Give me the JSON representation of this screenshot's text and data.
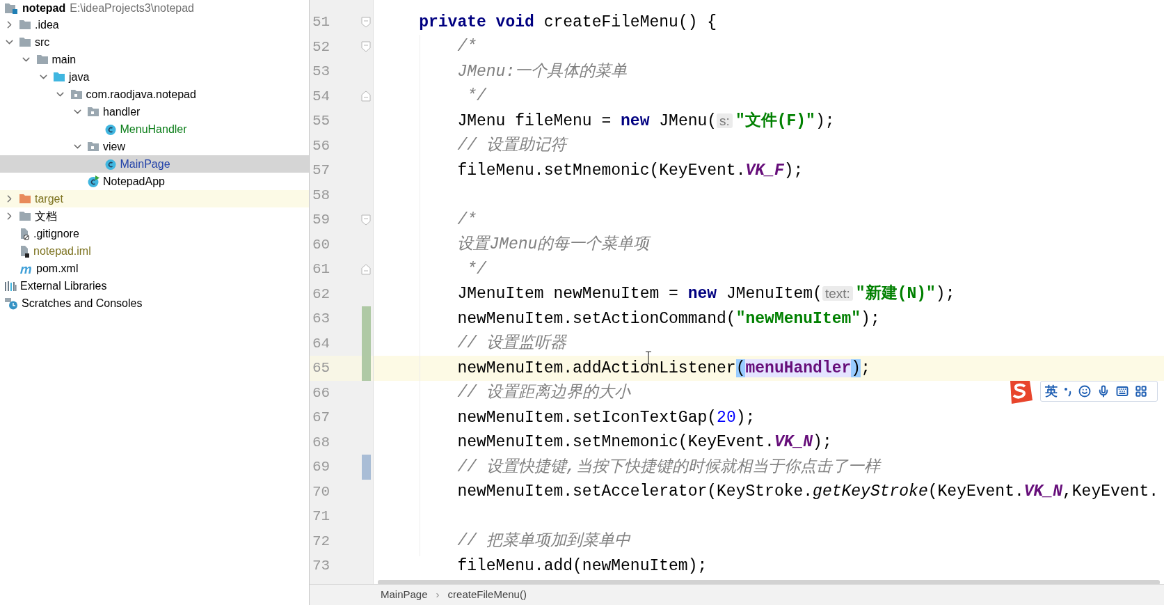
{
  "project": {
    "name": "notepad",
    "path": "E:\\ideaProjects3\\notepad",
    "tree": [
      {
        "label": ".idea",
        "kind": "folder",
        "color": "#000000",
        "expanded": false,
        "selected": false
      },
      {
        "label": "src",
        "kind": "folder",
        "color": "#000000",
        "expanded": true,
        "selected": false,
        "children": [
          {
            "label": "main",
            "kind": "folder",
            "color": "#000000",
            "expanded": true,
            "selected": false,
            "children": [
              {
                "label": "java",
                "kind": "sources",
                "color": "#000000",
                "expanded": true,
                "selected": false,
                "children": [
                  {
                    "label": "com.raodjava.notepad",
                    "kind": "package",
                    "color": "#000000",
                    "expanded": true,
                    "selected": false,
                    "children": [
                      {
                        "label": "handler",
                        "kind": "package",
                        "color": "#000000",
                        "expanded": true,
                        "selected": false,
                        "children": [
                          {
                            "label": "MenuHandler",
                            "kind": "class",
                            "color": "#0a7d18",
                            "selected": false
                          }
                        ]
                      },
                      {
                        "label": "view",
                        "kind": "package",
                        "color": "#000000",
                        "expanded": true,
                        "selected": false,
                        "children": [
                          {
                            "label": "MainPage",
                            "kind": "class",
                            "color": "#1f3fa8",
                            "selected": true
                          }
                        ]
                      },
                      {
                        "label": "NotepadApp",
                        "kind": "runnable",
                        "color": "#000000",
                        "selected": false
                      }
                    ]
                  }
                ]
              }
            ]
          }
        ]
      },
      {
        "label": "target",
        "kind": "excluded",
        "color": "#7d7320",
        "expanded": false,
        "selected": false
      },
      {
        "label": "文档",
        "kind": "folder",
        "color": "#000000",
        "expanded": false,
        "selected": false
      },
      {
        "label": ".gitignore",
        "kind": "ignorefile",
        "color": "#000000",
        "selected": false
      },
      {
        "label": "notepad.iml",
        "kind": "module",
        "color": "#7d7320",
        "selected": false
      },
      {
        "label": "pom.xml",
        "kind": "maven",
        "color": "#000000",
        "selected": false
      }
    ],
    "extras": [
      {
        "label": "External Libraries",
        "kind": "libraries",
        "selected": false
      },
      {
        "label": "Scratches and Consoles",
        "kind": "scratches",
        "selected": false
      }
    ]
  },
  "editor": {
    "lines": [
      {
        "number": "51",
        "current": false,
        "fold_open": true,
        "tokens": [
          {
            "t": "private void",
            "kind": "keyword"
          },
          {
            "t": " createFileMenu() {",
            "kind": "plain"
          }
        ],
        "children": [
          {
            "number": "52",
            "current": false,
            "fold_open": true,
            "tokens": [
              {
                "t": "/*",
                "kind": "comment"
              }
            ]
          },
          {
            "number": "53",
            "current": false,
            "tokens": [
              {
                "t": "JMenu:一个具体的菜单",
                "kind": "comment"
              }
            ]
          },
          {
            "number": "54",
            "current": false,
            "fold_open": false,
            "tokens": [
              {
                "t": "*/",
                "kind": "closer"
              }
            ]
          },
          {
            "number": "55",
            "current": false,
            "tokens": [
              {
                "t": "JMenu fileMenu = ",
                "kind": "plain"
              },
              {
                "t": "new",
                "kind": "keyword"
              },
              {
                "t": " JMenu(",
                "kind": "plain"
              },
              {
                "t": "s:",
                "kind": "hint"
              },
              {
                "t": "\"文件(F)\"",
                "kind": "string"
              },
              {
                "t": ");",
                "kind": "plain"
              }
            ]
          },
          {
            "number": "56",
            "current": false,
            "tokens": [
              {
                "t": "// 设置助记符",
                "kind": "comment"
              }
            ]
          },
          {
            "number": "57",
            "current": false,
            "tokens": [
              {
                "t": "fileMenu.setMnemonic(KeyEvent.",
                "kind": "plain"
              },
              {
                "t": "VK_F",
                "kind": "field"
              },
              {
                "t": ");",
                "kind": "plain"
              }
            ]
          },
          {
            "number": "58",
            "current": false
          },
          {
            "number": "59",
            "current": false,
            "fold_open": true,
            "tokens": [
              {
                "t": "/*",
                "kind": "comment"
              }
            ]
          },
          {
            "number": "60",
            "current": false,
            "tokens": [
              {
                "t": "设置JMenu的每一个菜单项",
                "kind": "comment"
              }
            ]
          },
          {
            "number": "61",
            "current": false,
            "fold_open": false,
            "tokens": [
              {
                "t": "*/",
                "kind": "closer"
              }
            ]
          },
          {
            "number": "62",
            "current": false,
            "tokens": [
              {
                "t": "JMenuItem newMenuItem = ",
                "kind": "plain"
              },
              {
                "t": "new",
                "kind": "keyword"
              },
              {
                "t": " JMenuItem(",
                "kind": "plain"
              },
              {
                "t": "text:",
                "kind": "hint"
              },
              {
                "t": "\"新建(N)\"",
                "kind": "string"
              },
              {
                "t": ");",
                "kind": "plain"
              }
            ]
          },
          {
            "number": "63",
            "kind": "added",
            "current": false,
            "tokens": [
              {
                "t": "newMenuItem.setActionCommand(",
                "kind": "plain"
              },
              {
                "t": "\"newMenuItem\"",
                "kind": "string"
              },
              {
                "t": ");",
                "kind": "plain"
              }
            ]
          },
          {
            "number": "64",
            "kind": "added",
            "current": false,
            "tokens": [
              {
                "t": "// 设置监听器",
                "kind": "comment"
              }
            ]
          },
          {
            "number": "65",
            "kind": "added",
            "current": true,
            "tokens": [
              {
                "t": "newMenuItem.addActionListener",
                "kind": "plain"
              },
              {
                "t": "(",
                "kind": "brace"
              },
              {
                "t": "menuHandler",
                "kind": "usage"
              },
              {
                "t": ")",
                "kind": "brace"
              },
              {
                "t": ";",
                "kind": "plain"
              }
            ]
          },
          {
            "number": "66",
            "current": false,
            "tokens": [
              {
                "t": "// 设置距离边界的大小",
                "kind": "comment"
              }
            ]
          },
          {
            "number": "67",
            "current": false,
            "tokens": [
              {
                "t": "newMenuItem.setIconTextGap(",
                "kind": "plain"
              },
              {
                "t": "20",
                "kind": "number"
              },
              {
                "t": ");",
                "kind": "plain"
              }
            ]
          },
          {
            "number": "68",
            "current": false,
            "tokens": [
              {
                "t": "newMenuItem.setMnemonic(KeyEvent.",
                "kind": "plain"
              },
              {
                "t": "VK_N",
                "kind": "field"
              },
              {
                "t": ");",
                "kind": "plain"
              }
            ]
          },
          {
            "number": "69",
            "kind": "modified",
            "current": false,
            "tokens": [
              {
                "t": "// 设置快捷键,当按下快捷键的时候就相当于你点击了一样",
                "kind": "comment"
              }
            ]
          },
          {
            "number": "70",
            "current": false,
            "tokens": [
              {
                "t": "newMenuItem.setAccelerator(KeyStroke.",
                "kind": "plain"
              },
              {
                "t": "getKeyStroke",
                "kind": "static"
              },
              {
                "t": "(KeyEvent.",
                "kind": "plain"
              },
              {
                "t": "VK_N",
                "kind": "field"
              },
              {
                "t": ",KeyEvent.",
                "kind": "plain"
              }
            ]
          },
          {
            "number": "71",
            "current": false
          },
          {
            "number": "72",
            "current": false,
            "tokens": [
              {
                "t": "// 把菜单项加到菜单中",
                "kind": "comment"
              }
            ]
          },
          {
            "number": "73",
            "current": false,
            "tokens": [
              {
                "t": "fileMenu.add(newMenuItem);",
                "kind": "plain"
              }
            ]
          }
        ]
      }
    ]
  },
  "breadcrumbs": [
    {
      "label": "MainPage",
      "kind": "crumb"
    },
    {
      "label": "›",
      "kind": "separator"
    },
    {
      "label": "createFileMenu()",
      "kind": "crumb"
    }
  ],
  "ime_toolbar": {
    "language": "英"
  }
}
